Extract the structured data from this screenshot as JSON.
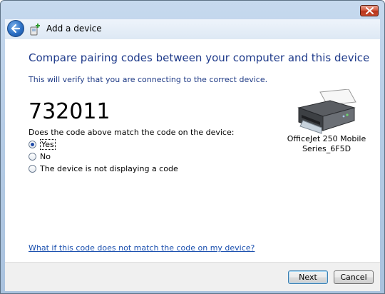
{
  "window": {
    "title": "Add a device"
  },
  "header": {
    "title": "Add a device"
  },
  "content": {
    "heading": "Compare pairing codes between your computer and this device",
    "subtext": "This will verify that you are connecting to the correct device.",
    "code": "732011",
    "question": "Does the code above match the code on the device:",
    "options": [
      {
        "label": "Yes",
        "checked": true
      },
      {
        "label": "No",
        "checked": false
      },
      {
        "label": "The device is not displaying a code",
        "checked": false
      }
    ],
    "device": {
      "name_line1": "OfficeJet 250 Mobile",
      "name_line2": "Series_6F5D",
      "icon": "printer-icon"
    },
    "help_link": "What if this code does not match the code on my device?"
  },
  "footer": {
    "next_label": "Next",
    "cancel_label": "Cancel"
  },
  "colors": {
    "heading": "#1e3a8a",
    "link": "#1a4fae",
    "close_button": "#c64a2c"
  }
}
